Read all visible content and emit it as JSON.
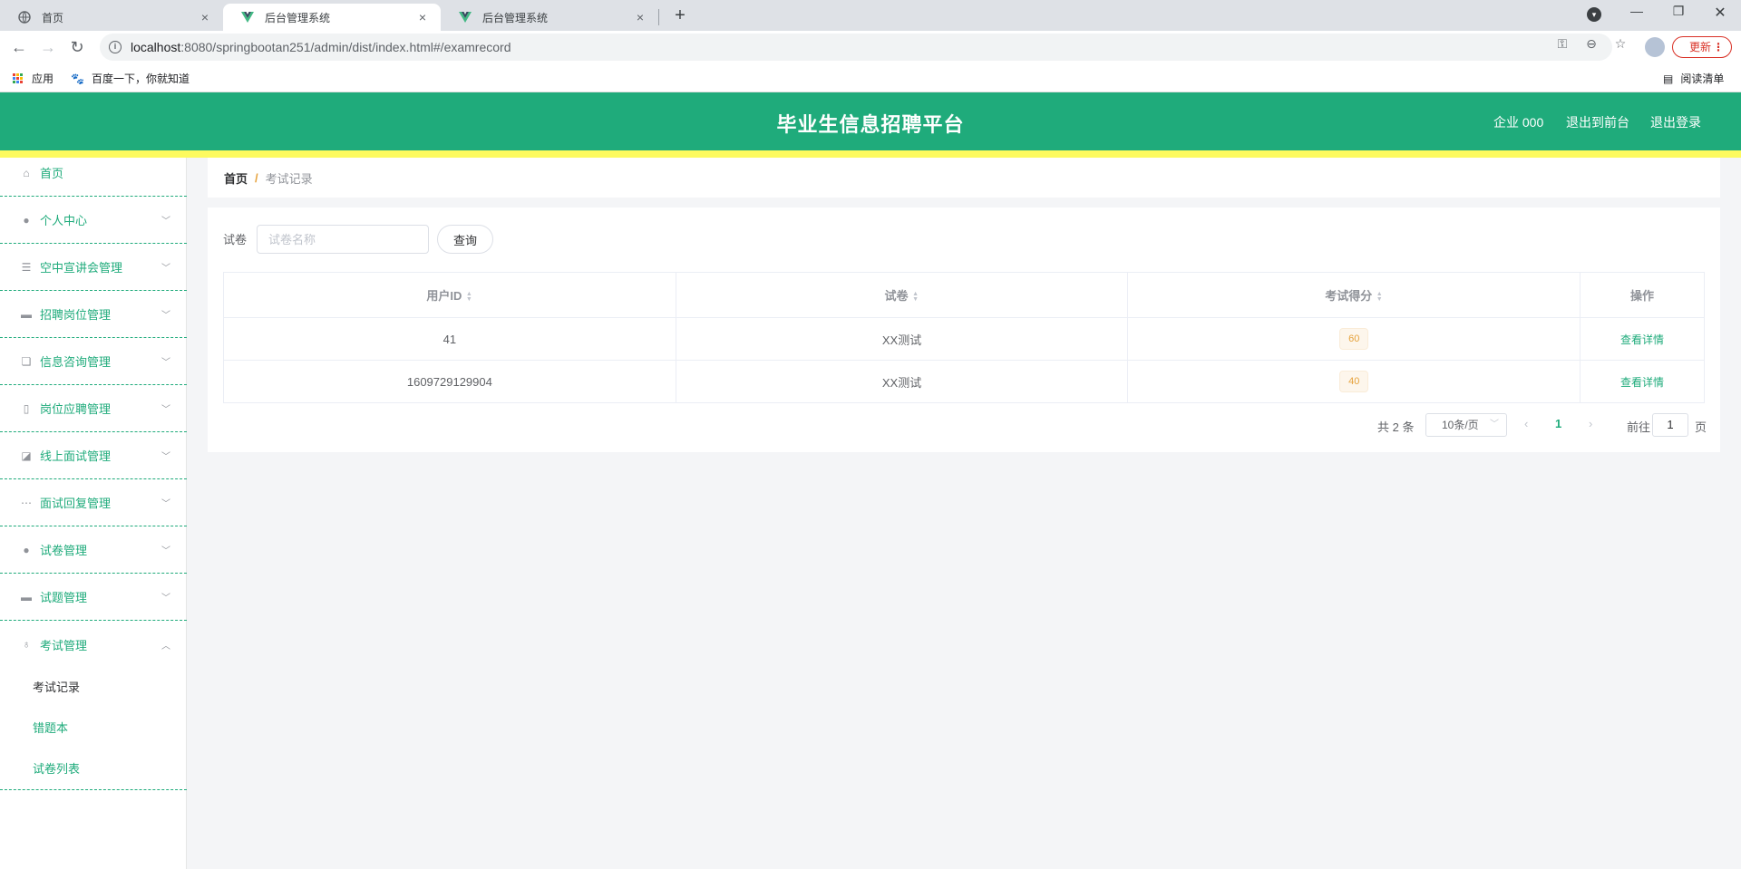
{
  "browser": {
    "tabs": [
      {
        "title": "首页",
        "close": "×"
      },
      {
        "title": "后台管理系统",
        "close": "×"
      },
      {
        "title": "后台管理系统",
        "close": "×"
      }
    ],
    "new_tab": "+",
    "url_host": "localhost",
    "url_rest": ":8080/springbootan251/admin/dist/index.html#/examrecord",
    "update_label": "更新",
    "bookmarks": {
      "apps": "应用",
      "baidu": "百度一下，你就知道",
      "reading_list": "阅读清单"
    }
  },
  "header": {
    "title": "毕业生信息招聘平台",
    "user": "企业 000",
    "to_front": "退出到前台",
    "logout": "退出登录"
  },
  "sidebar": {
    "items": [
      {
        "label": "首页",
        "icon": "home-icon"
      },
      {
        "label": "个人中心",
        "icon": "user-icon"
      },
      {
        "label": "空中宣讲会管理",
        "icon": "list-icon"
      },
      {
        "label": "招聘岗位管理",
        "icon": "monitor-icon"
      },
      {
        "label": "信息咨询管理",
        "icon": "copy-icon"
      },
      {
        "label": "岗位应聘管理",
        "icon": "mic-icon"
      },
      {
        "label": "线上面试管理",
        "icon": "chart-icon"
      },
      {
        "label": "面试回复管理",
        "icon": "chat-icon"
      },
      {
        "label": "试卷管理",
        "icon": "pin-icon"
      },
      {
        "label": "试题管理",
        "icon": "box-icon"
      },
      {
        "label": "考试管理",
        "icon": "microphone-icon"
      }
    ],
    "submenu": [
      {
        "label": "考试记录"
      },
      {
        "label": "错题本"
      },
      {
        "label": "试卷列表"
      }
    ]
  },
  "breadcrumb": {
    "home": "首页",
    "sep": "/",
    "current": "考试记录"
  },
  "search": {
    "label": "试卷",
    "placeholder": "试卷名称",
    "button": "查询"
  },
  "table": {
    "headers": [
      "用户ID",
      "试卷",
      "考试得分",
      "操作"
    ],
    "rows": [
      {
        "user_id": "41",
        "paper": "XX测试",
        "score": "60",
        "action": "查看详情"
      },
      {
        "user_id": "1609729129904",
        "paper": "XX测试",
        "score": "40",
        "action": "查看详情"
      }
    ]
  },
  "pagination": {
    "total": "共 2 条",
    "page_size": "10条/页",
    "current_page": "1",
    "goto": "前往",
    "jump_value": "1",
    "page_suffix": "页"
  },
  "colors": {
    "primary": "#1fab7b",
    "accent_bar": "#fdfa5f",
    "score_tag": "#e6a23c"
  }
}
